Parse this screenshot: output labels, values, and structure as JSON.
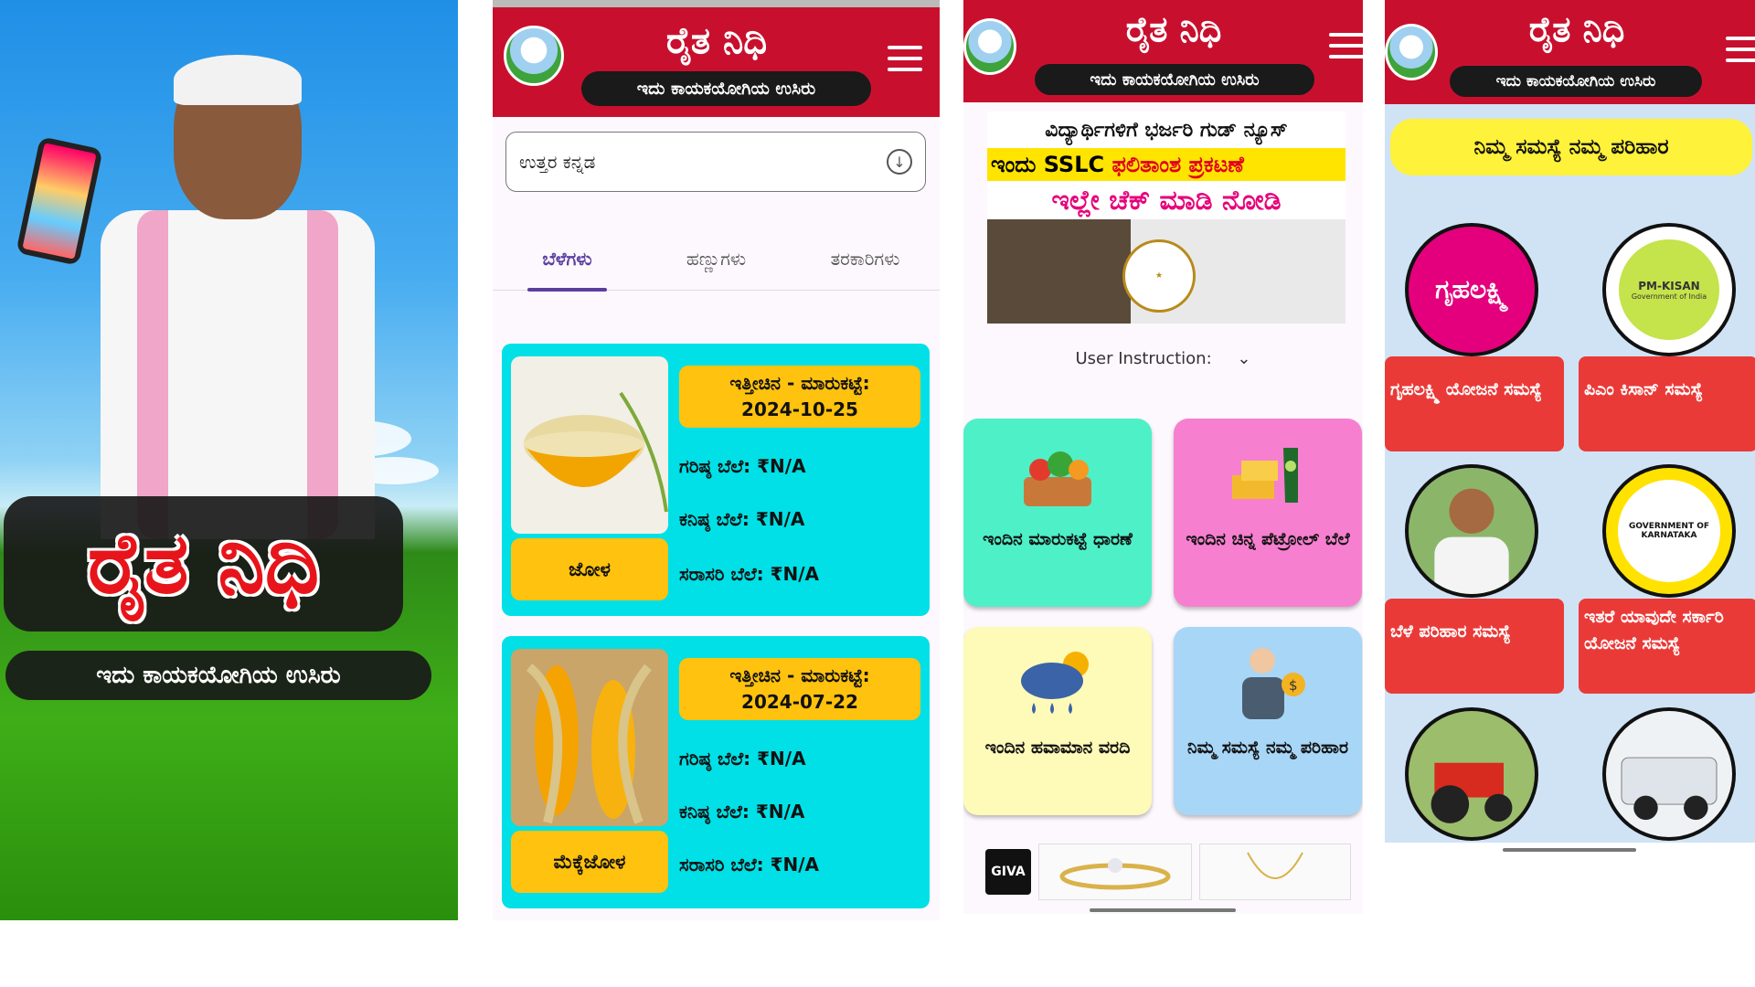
{
  "colors": {
    "header_red": "#c8102e",
    "card_cyan": "#00e0e6",
    "card_yellow": "#ffc20e",
    "tab_purple": "#5a3fa0",
    "problem_red": "#ea3a38",
    "banner_yellow": "#fff23a"
  },
  "splash": {
    "title": "ರೈತ ನಿಧಿ",
    "subtitle": "ಇದು ಕಾಯಕಯೋಗಿಯ ಉಸಿರು"
  },
  "header": {
    "title": "ರೈತ ನಿಧಿ",
    "tagline": "ಇದು ಕಾಯಕಯೋಗಿಯ ಉಸಿರು",
    "logo_icon": "farmer-logo-icon",
    "menu_icon": "hamburger-menu-icon"
  },
  "market": {
    "district": "ಉತ್ತರ ಕನ್ನಡ",
    "tabs": [
      "ಬೆಳೆಗಳು",
      "ಹಣ್ಣುಗಳು",
      "ತರಕಾರಿಗಳು"
    ],
    "active_tab": 0,
    "cards": [
      {
        "name": "ಜೋಳ",
        "date_label": "ಇತ್ತೀಚಿನ - ಮಾರುಕಟ್ಟೆ:",
        "date": "2024-10-25",
        "max_label": "ಗರಿಷ್ಠ ಬೆಲೆ:",
        "max": "₹N/A",
        "min_label": "ಕನಿಷ್ಠ ಬೆಲೆ:",
        "min": "₹N/A",
        "avg_label": "ಸರಾಸರಿ ಬೆಲೆ:",
        "avg": "₹N/A"
      },
      {
        "name": "ಮೆಕ್ಕೆಜೋಳ",
        "date_label": "ಇತ್ತೀಚಿನ - ಮಾರುಕಟ್ಟೆ:",
        "date": "2024-07-22",
        "max_label": "ಗರಿಷ್ಠ ಬೆಲೆ:",
        "max": "₹N/A",
        "min_label": "ಕನಿಷ್ಠ ಬೆಲೆ:",
        "min": "₹N/A",
        "avg_label": "ಸರಾಸರಿ ಬೆಲೆ:",
        "avg": "₹N/A"
      }
    ]
  },
  "home": {
    "news": {
      "line1": "ವಿದ್ಯಾರ್ಥಿಗಳಿಗೆ ಭರ್ಜರಿ ಗುಡ್ ನ್ಯೂಸ್",
      "line2a": "ಇಂದು SSLC",
      "line2b": "ಫಲಿತಾಂಶ ಪ್ರಕಟಣೆ",
      "line3": "ಇಲ್ಲೇ ಚೆಕ್ ಮಾಡಿ ನೋಡಿ"
    },
    "instruction": "User Instruction:",
    "tiles": [
      {
        "label": "ಇಂದಿನ ಮಾರುಕಟ್ಟೆ ಧಾರಣೆ",
        "icon": "vegetable-basket-icon"
      },
      {
        "label": "ಇಂದಿನ ಚಿನ್ನ ಪೆಟ್ರೋಲ್ ಬೆಲೆ",
        "icon": "gold-fuel-icon"
      },
      {
        "label": "ಇಂದಿನ ಹವಾಮಾನ ವರದಿ",
        "icon": "weather-cloud-icon"
      },
      {
        "label": "ನಿಮ್ಮ ಸಮಸ್ಯೆ ನಮ್ಮ ಪರಿಹಾರ",
        "icon": "advisor-icon"
      }
    ],
    "ad_brand": "GIVA"
  },
  "problems": {
    "banner": "ನಿಮ್ಮ ಸಮಸ್ಯೆ ನಮ್ಮ ಪರಿಹಾರ",
    "gruhalakshmi_logo": "ಗೃಹಲಕ್ಷ್ಮಿ",
    "pmkisan_logo": "PM-KISAN",
    "pmkisan_sub": "Government of India",
    "karnataka_seal": "GOVERNMENT OF KARNATAKA",
    "buttons": [
      "ಗೃಹಲಕ್ಷ್ಮಿ ಯೋಜನೆ ಸಮಸ್ಯೆ",
      "ಪಿಎಂ ಕಿಸಾನ್ ಸಮಸ್ಯೆ",
      "ಬೆಳೆ ಪರಿಹಾರ ಸಮಸ್ಯೆ",
      "ಇತರೆ ಯಾವುದೇ ಸರ್ಕಾರಿ ಯೋಜನೆ ಸಮಸ್ಯೆ"
    ]
  }
}
